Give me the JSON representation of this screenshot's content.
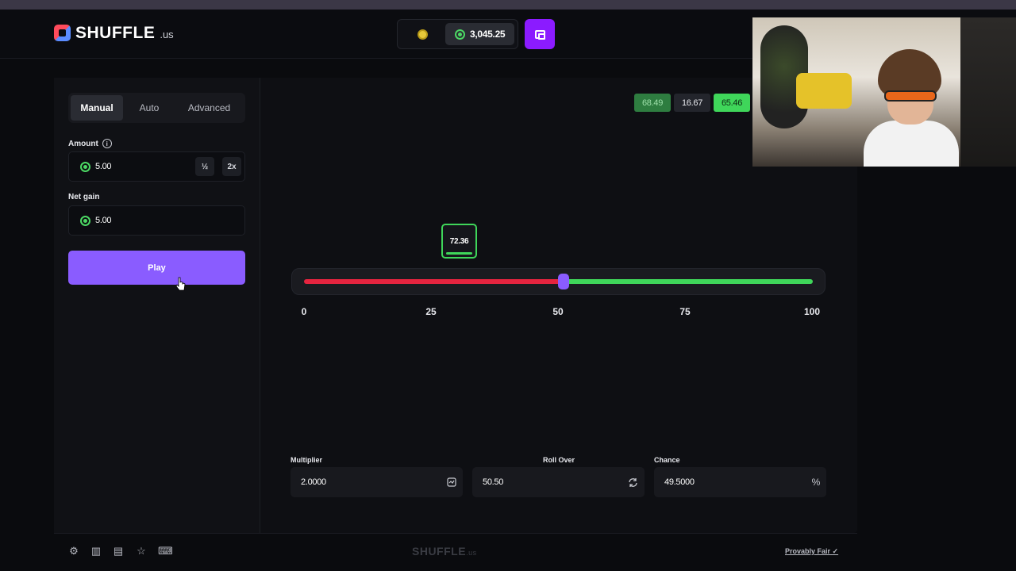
{
  "header": {
    "logo_text": "SHUFFLE",
    "logo_suffix": ".us",
    "balance": "3,045.25"
  },
  "sidebar": {
    "tabs": [
      "Manual",
      "Auto",
      "Advanced"
    ],
    "amount_label": "Amount",
    "amount_value": "5.00",
    "half_label": "½",
    "double_label": "2x",
    "net_gain_label": "Net gain",
    "net_gain_value": "5.00",
    "play_label": "Play"
  },
  "game": {
    "recent_results": [
      "68.49",
      "16.67",
      "65.46"
    ],
    "result": "72.36",
    "ticks": [
      "0",
      "25",
      "50",
      "75",
      "100"
    ],
    "multiplier_label": "Multiplier",
    "multiplier_value": "2.0000",
    "roll_over_label": "Roll Over",
    "roll_over_value": "50.50",
    "chance_label": "Chance",
    "chance_value": "49.5000",
    "chance_suffix": "%"
  },
  "footer": {
    "logo_text": "SHUFFLE",
    "logo_suffix": ".us",
    "provably_fair": "Provably Fair"
  },
  "colors": {
    "accent": "#8a5cff",
    "win": "#3fd65a",
    "lose": "#e5243f",
    "wallet": "#8b1bff"
  }
}
